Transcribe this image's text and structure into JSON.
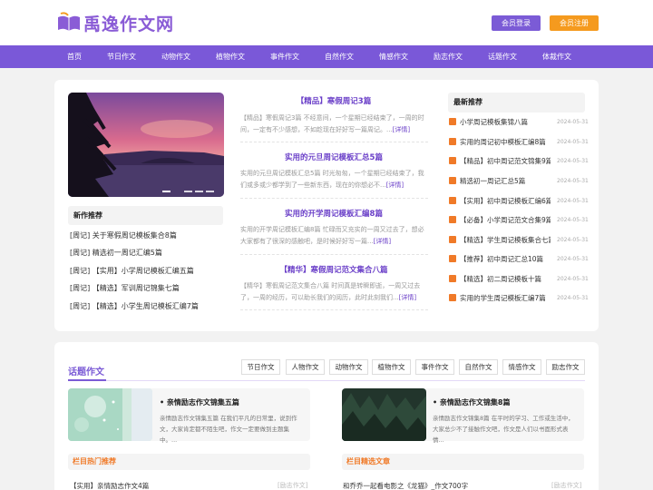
{
  "site": {
    "name": "禹逸作文网",
    "login": "会员登录",
    "register": "会员注册"
  },
  "nav": [
    "首页",
    "节日作文",
    "动物作文",
    "植物作文",
    "事件作文",
    "自然作文",
    "情感作文",
    "励志作文",
    "话题作文",
    "体裁作文"
  ],
  "new_recommend": {
    "title": "新作推荐",
    "items": [
      "[周记] 关于寒假周记模板集合8篇",
      "[周记] 精选初一周记汇编5篇",
      "[周记] 【实用】小学周记模板汇编五篇",
      "[周记] 【精选】军训周记锦集七篇",
      "[周记] 【精选】小学生周记模板汇编7篇"
    ]
  },
  "articles": [
    {
      "title": "【精品】寒假周记3篇",
      "body": "【精品】寒假周记3篇 不经意间，一个星期已经结束了，一周的时间，一定有不少感想，不如趁现在好好写一篇周记。...",
      "more": "[详情]"
    },
    {
      "title": "实用的元旦周记模板汇总5篇",
      "body": "实用的元旦周记模板汇总5篇 时光匆匆，一个星期已经结束了，我们或多或少都学到了一些新东西，现在的你想必不...",
      "more": "[详情]"
    },
    {
      "title": "实用的开学周记模板汇编8篇",
      "body": "实用的开学周记模板汇编8篇 忙碌而又充实的一周又过去了，想必大家都有了很深的感触吧，是时候好好写一篇...",
      "more": "[详情]"
    },
    {
      "title": "【精华】寒假周记范文集合八篇",
      "body": "【精华】寒假周记范文集合八篇 时间真是转瞬即逝，一周又过去了，一周的经历，可以助长我们的阅历，此时此刻我们...",
      "more": "[详情]"
    }
  ],
  "latest": {
    "title": "最新推荐",
    "items": [
      {
        "text": "小学周记模板集锦八篇",
        "date": "2024-05-31"
      },
      {
        "text": "实用的周记初中模板汇编8篇",
        "date": "2024-05-31"
      },
      {
        "text": "【精品】初中周记范文锦集9篇",
        "date": "2024-05-31"
      },
      {
        "text": "精选初一周记汇总5篇",
        "date": "2024-05-31"
      },
      {
        "text": "【实用】初中周记模板汇编6篇",
        "date": "2024-05-31"
      },
      {
        "text": "【必备】小学周记范文合集9篇",
        "date": "2024-05-31"
      },
      {
        "text": "【精选】学生周记模板集合七篇",
        "date": "2024-05-31"
      },
      {
        "text": "【推荐】初中周记汇总10篇",
        "date": "2024-05-31"
      },
      {
        "text": "【精选】初二周记模板十篇",
        "date": "2024-05-31"
      },
      {
        "text": "实用的学生周记模板汇编7篇",
        "date": "2024-05-31"
      }
    ]
  },
  "topic": {
    "title": "话题作文",
    "tags": [
      "节日作文",
      "人物作文",
      "动物作文",
      "植物作文",
      "事件作文",
      "自然作文",
      "情感作文",
      "励志作文"
    ],
    "features": [
      {
        "title": "亲情励志作文锦集五篇",
        "body": "亲情励志作文锦集五篇 在我们平凡的日常里，说到作文，大家肯定都不陌生吧，作文一定要做到主题集中。..."
      },
      {
        "title": "亲情励志作文锦集8篇",
        "body": "亲情励志作文锦集8篇 在平时的学习、工作或生活中，大家总少不了接触作文吧，作文是人们以书面形式表情..."
      }
    ],
    "col_hot": "栏目热门推荐",
    "col_pick": "栏目精选文章",
    "hot_item": "【实用】亲情励志作文4篇",
    "hot_cat": "[励志作文]",
    "pick_item": "和乔乔一起看电影之《龙猫》_作文700字",
    "pick_cat": "[励志作文]"
  },
  "colors": {
    "brand": "#7a58d8",
    "accent": "#f59a1e",
    "badge": "#f07a28"
  }
}
